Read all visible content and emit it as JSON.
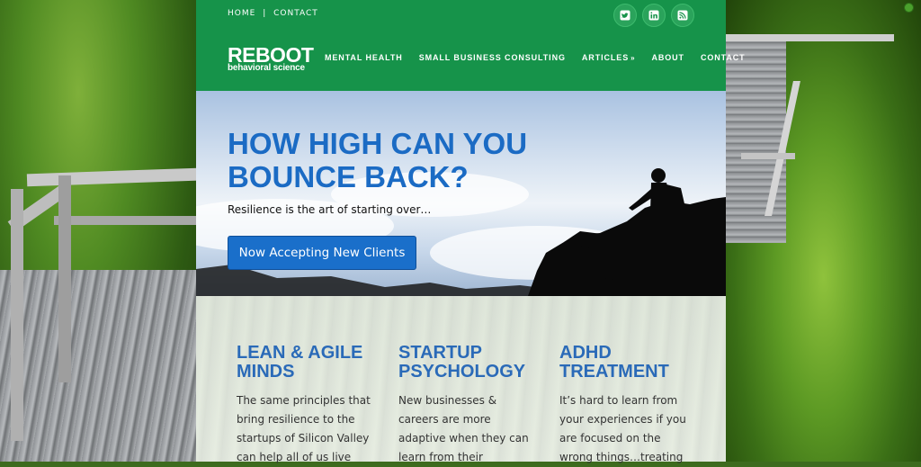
{
  "header": {
    "utility_links": [
      "HOME",
      "CONTACT"
    ],
    "utility_separator": "|",
    "social_icons": [
      "twitter-icon",
      "linkedin-icon",
      "rss-icon"
    ],
    "logo": {
      "title": "REBOOT",
      "subtitle": "behavioral science"
    },
    "nav": [
      {
        "label": "MENTAL HEALTH"
      },
      {
        "label": "SMALL BUSINESS CONSULTING"
      },
      {
        "label": "ARTICLES",
        "has_dropdown": true
      },
      {
        "label": "ABOUT"
      },
      {
        "label": "CONTACT"
      }
    ],
    "colors": {
      "header_bg": "#16934a",
      "accent": "#1a6fca",
      "heading": "#2a6ab8"
    }
  },
  "hero": {
    "headline_line1": "HOW HIGH CAN YOU",
    "headline_line2": "BOUNCE BACK?",
    "subtitle": "Resilience is the art of starting over…",
    "cta_label": "Now Accepting New Clients"
  },
  "features": [
    {
      "title_line1": "LEAN & AGILE",
      "title_line2": "MINDS",
      "text": "The same principles that bring resilience to the startups of Silicon Valley can help all of us live"
    },
    {
      "title_line1": "STARTUP",
      "title_line2": "PSYCHOLOGY",
      "text": "New businesses & careers are more adaptive when they can learn from their"
    },
    {
      "title_line1": "ADHD",
      "title_line2": "TREATMENT",
      "text": "It’s hard to learn from your experiences if you are focused on the wrong things…treating"
    }
  ]
}
